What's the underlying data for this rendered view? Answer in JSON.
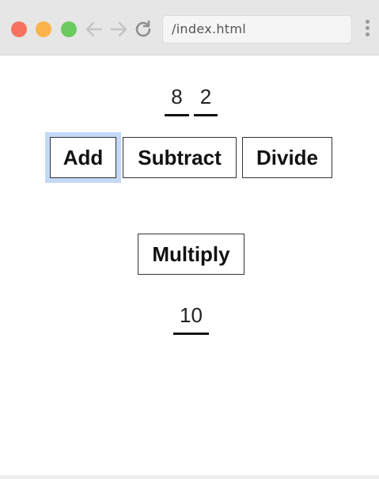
{
  "browser": {
    "url": "/index.html"
  },
  "calculator": {
    "operand_a": "8",
    "operand_b": "2",
    "buttons": {
      "add": "Add",
      "subtract": "Subtract",
      "divide": "Divide",
      "multiply": "Multiply"
    },
    "result": "10"
  },
  "colors": {
    "focus_ring": "#c3d9f7",
    "traffic_red": "#f7735f",
    "traffic_yellow": "#fbb44b",
    "traffic_green": "#6ccb5f"
  }
}
